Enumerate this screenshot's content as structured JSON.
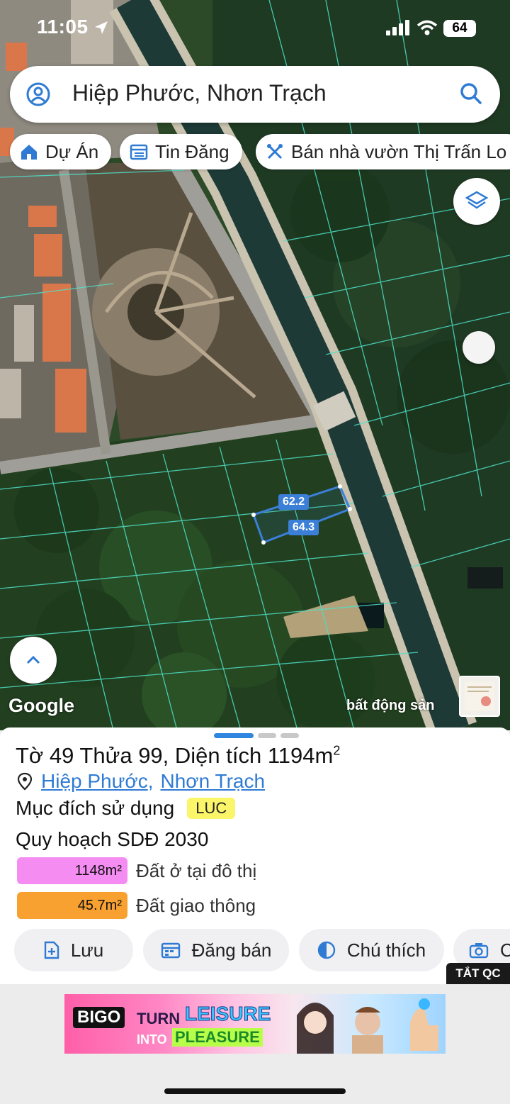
{
  "status_bar": {
    "time": "11:05",
    "battery": "64"
  },
  "search": {
    "query": "Hiệp Phước, Nhơn Trạch"
  },
  "chips": [
    {
      "label": "Dự Án",
      "icon": "home-icon"
    },
    {
      "label": "Tin Đăng",
      "icon": "list-icon"
    },
    {
      "label": "Bán nhà vườn Thị Trấn Lo",
      "icon": "tools-icon"
    }
  ],
  "map": {
    "parcel_labels": [
      "62.2",
      "64.3"
    ],
    "attribution": "Google",
    "watermark": "bất động sản"
  },
  "sheet": {
    "title_prefix": "Tờ 49 Thửa 99, Diện tích 1194m",
    "title_sup": "2",
    "address": {
      "commune": "Hiệp Phước",
      "separator": ",",
      "district": "Nhơn Trạch"
    },
    "purpose_label": "Mục đích sử dụng",
    "purpose_code": "LUC",
    "plan_label": "Quy hoạch SDĐ 2030",
    "zones": [
      {
        "area": "1148m²",
        "label": "Đất ở tại đô thị",
        "color": "#f58cf2"
      },
      {
        "area": "45.7m²",
        "label": "Đất giao thông",
        "color": "#f8a030"
      }
    ],
    "actions": [
      {
        "label": "Lưu",
        "icon": "save-icon"
      },
      {
        "label": "Đăng bán",
        "icon": "calendar-icon"
      },
      {
        "label": "Chú thích",
        "icon": "contrast-icon"
      },
      {
        "label": "C",
        "icon": "camera-icon"
      }
    ]
  },
  "ad": {
    "close_label": "TẮT QC",
    "brand": "BIGO",
    "line1a": "TURN",
    "line1b": "LEISURE",
    "line2a": "INTO",
    "line2b": "PLEASURE"
  },
  "colors": {
    "accent": "#2f86de",
    "link": "#2f7bd4",
    "parcel": "#3b7fd8"
  }
}
